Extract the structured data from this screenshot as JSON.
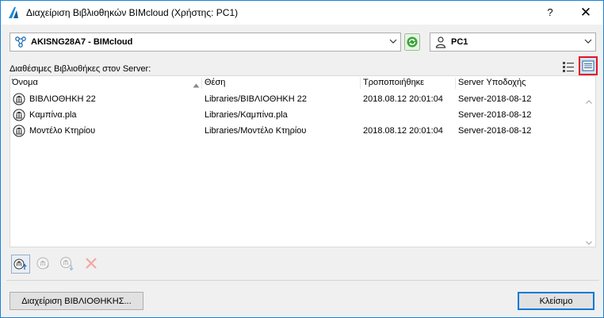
{
  "window": {
    "title": "Διαχείριση Βιβλιοθηκών BIMcloud (Χρήστης: PC1)",
    "help_label": "?",
    "close_label": "✕"
  },
  "server_combo": {
    "value": "AKISNG28A7 - BIMcloud",
    "icon": "cloud-network-icon"
  },
  "user_combo": {
    "value": "PC1",
    "icon": "user-icon"
  },
  "section_label": "Διαθέσιμες Βιβλιοθήκες στον Server:",
  "view_modes": {
    "active": "list-view",
    "options": [
      "details-view",
      "list-view"
    ]
  },
  "table": {
    "columns": [
      "Όνομα",
      "Θέση",
      "Τροποποιήθηκε",
      "Server Υποδοχής"
    ],
    "sort_column": "Όνομα",
    "rows": [
      {
        "name": "ΒΙΒΛΙΟΘΗΚΗ 22",
        "location": "Libraries/ΒΙΒΛΙΟΘΗΚΗ 22",
        "modified": "2018.08.12 20:01:04",
        "server": "Server-2018-08-12"
      },
      {
        "name": "Καμπίνα.pla",
        "location": "Libraries/Καμπίνα.pla",
        "modified": "",
        "server": "Server-2018-08-12"
      },
      {
        "name": "Μοντέλο Κτηρίου",
        "location": "Libraries/Μοντέλο Κτηρίου",
        "modified": "2018.08.12 20:01:04",
        "server": "Server-2018-08-12"
      }
    ]
  },
  "buttons": {
    "manage": "Διαχείριση ΒΙΒΛΙΟΘΗΚΗΣ...",
    "close": "Κλείσιμο"
  },
  "colors": {
    "accent": "#0078d7",
    "highlight": "#e81123",
    "refresh": "#3aa335"
  }
}
